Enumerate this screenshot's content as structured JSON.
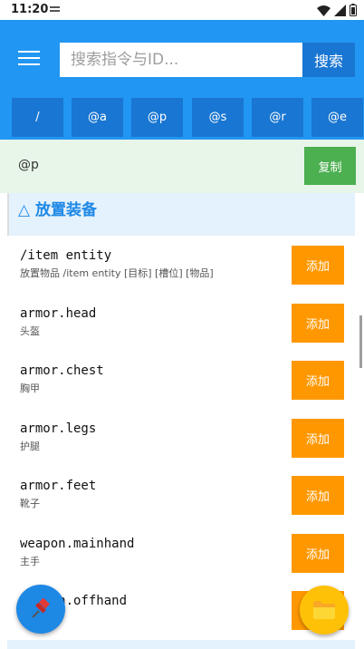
{
  "status_bar": {
    "time": "11:20"
  },
  "search": {
    "placeholder": "搜索指令与ID...",
    "value": "",
    "button_label": "搜索"
  },
  "chips": [
    "/",
    "@a",
    "@p",
    "@s",
    "@r",
    "@e"
  ],
  "preview": {
    "text": "@p",
    "copy_label": "复制"
  },
  "section": {
    "title": "△ 放置装备"
  },
  "items": [
    {
      "name": "/item entity",
      "desc": "放置物品 /item entity [目标] [槽位] [物品]",
      "button": "添加"
    },
    {
      "name": "armor.head",
      "desc": "头盔",
      "button": "添加"
    },
    {
      "name": "armor.chest",
      "desc": "胸甲",
      "button": "添加"
    },
    {
      "name": "armor.legs",
      "desc": "护腿",
      "button": "添加"
    },
    {
      "name": "armor.feet",
      "desc": "靴子",
      "button": "添加"
    },
    {
      "name": "weapon.mainhand",
      "desc": "主手",
      "button": "添加"
    },
    {
      "name": "weapon.offhand",
      "desc": "",
      "button": "添加"
    }
  ],
  "colors": {
    "primary": "#2196f3",
    "primary_dark": "#1976d2",
    "accent_add": "#ff9800",
    "copy": "#4caf50",
    "preview_bg": "#e8f5e9",
    "section_bg": "#e3f2fd"
  },
  "icons": {
    "menu": "hamburger-icon",
    "pin": "pushpin-icon",
    "folder": "folder-icon"
  }
}
